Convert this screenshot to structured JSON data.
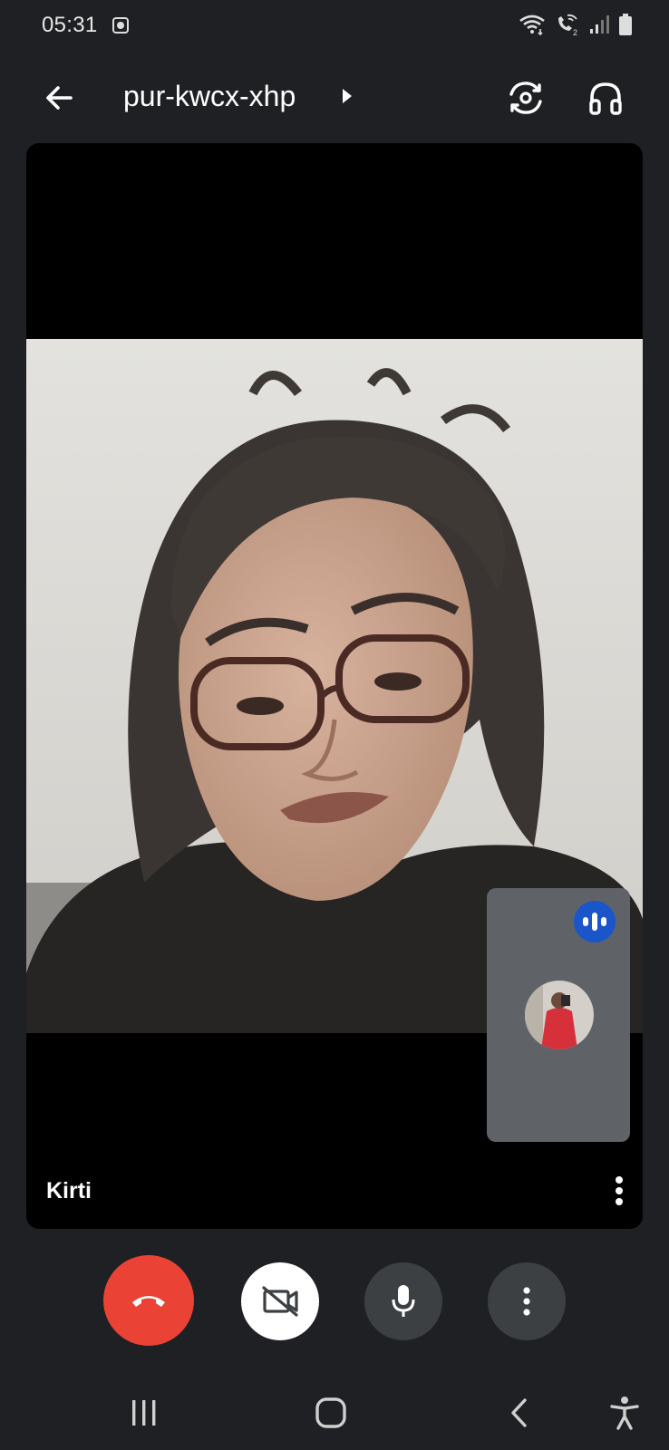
{
  "status_bar": {
    "time": "05:31",
    "icons": [
      "notification-icon",
      "wifi-icon",
      "wifi-calling-icon",
      "signal-icon",
      "battery-icon"
    ]
  },
  "top_bar": {
    "meeting_code": "pur-kwcx-xhp",
    "icons": [
      "arrow-back-icon",
      "caret-right-icon",
      "switch-camera-icon",
      "headphones-icon"
    ]
  },
  "video": {
    "participant_name": "Kirti",
    "self_tile_speaking": true
  },
  "controls": {
    "buttons": [
      "end-call",
      "camera-off",
      "microphone",
      "more-options"
    ]
  },
  "nav_bar": {
    "buttons": [
      "recents",
      "home",
      "back",
      "accessibility"
    ]
  },
  "colors": {
    "background": "#1f2023",
    "end_call": "#ea4335",
    "button_dark": "#3c4043",
    "self_tile": "#5f6368",
    "speaking_indicator": "#1a56c9"
  }
}
